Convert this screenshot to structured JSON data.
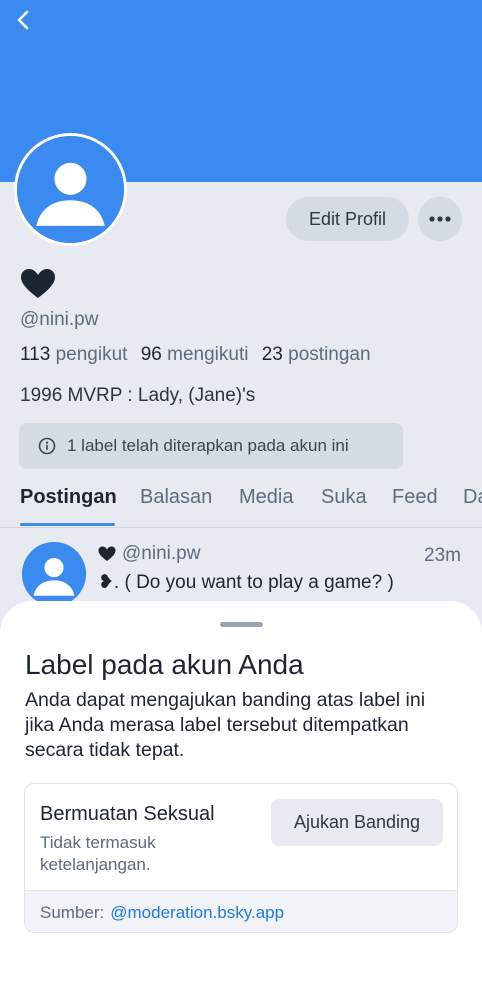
{
  "profile": {
    "handle": "@nini.pw",
    "edit_label": "Edit Profil",
    "stats": {
      "followers_count": "113",
      "followers_label": "pengikut",
      "following_count": "96",
      "following_label": "mengikuti",
      "posts_count": "23",
      "posts_label": "postingan"
    },
    "bio": "1996 MVRP : Lady, (Jane)'s",
    "label_notice": "1 label telah diterapkan pada akun ini"
  },
  "tabs": [
    "Postingan",
    "Balasan",
    "Media",
    "Suka",
    "Feed",
    "Da"
  ],
  "post": {
    "handle": "@nini.pw",
    "time": "23m",
    "text": "❥. ( Do you want to play a game? )"
  },
  "sheet": {
    "title": "Label pada akun Anda",
    "description": "Anda dapat mengajukan banding atas label ini jika Anda merasa label tersebut ditempatkan secara tidak tepat.",
    "card": {
      "title": "Bermuatan Seksual",
      "subtitle": "Tidak termasuk ketelanjangan.",
      "appeal_label": "Ajukan Banding",
      "source_label": "Sumber:",
      "source_link": "@moderation.bsky.app"
    }
  },
  "colors": {
    "accent": "#3a8af0",
    "background": "#e7ebf1",
    "link": "#1f7be0"
  },
  "icons": {
    "back": "chevron-left-icon",
    "more": "ellipsis-icon",
    "info": "info-circle-icon",
    "heart": "black-heart-icon"
  }
}
